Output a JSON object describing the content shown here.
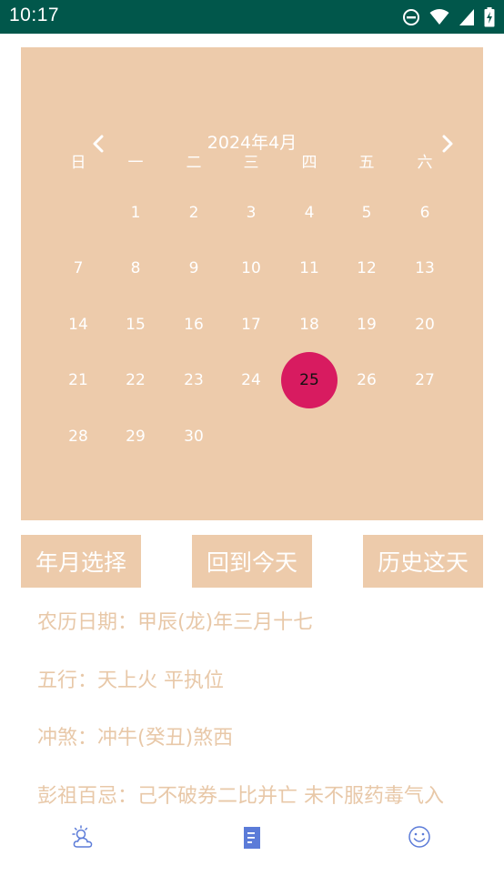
{
  "status_bar": {
    "time": "10:17",
    "icons": [
      "do-not-disturb-icon",
      "wifi-icon",
      "signal-icon",
      "battery-charging-icon"
    ]
  },
  "calendar": {
    "month_title": "2024年4月",
    "prev_icon": "chevron-left-icon",
    "next_icon": "chevron-right-icon",
    "weekdays": [
      "日",
      "一",
      "二",
      "三",
      "四",
      "五",
      "六"
    ],
    "weeks": [
      [
        "",
        "1",
        "2",
        "3",
        "4",
        "5",
        "6"
      ],
      [
        "7",
        "8",
        "9",
        "10",
        "11",
        "12",
        "13"
      ],
      [
        "14",
        "15",
        "16",
        "17",
        "18",
        "19",
        "20"
      ],
      [
        "21",
        "22",
        "23",
        "24",
        "25",
        "26",
        "27"
      ],
      [
        "28",
        "29",
        "30",
        "",
        "",
        "",
        ""
      ]
    ],
    "selected_day": "25",
    "colors": {
      "background": "#edcbab",
      "selected": "#d81b60",
      "text": "#ffffff"
    }
  },
  "actions": {
    "year_month_select": "年月选择",
    "back_to_today": "回到今天",
    "history_today": "历史这天"
  },
  "info": {
    "lunar": "农历日期：甲辰(龙)年三月十七",
    "wuxing": "五行：天上火 平执位",
    "chongsha": "冲煞：冲牛(癸丑)煞西",
    "pengzu": "彭祖百忌：己不破券二比并亡 未不服药毒气入"
  },
  "bottom_nav": {
    "items": [
      "weather-icon",
      "calendar-doc-icon",
      "smiley-icon"
    ],
    "active_color": "#5b7bd8"
  },
  "theme": {
    "status_bar": "#01574b",
    "info_text": "#e8c8a8"
  }
}
